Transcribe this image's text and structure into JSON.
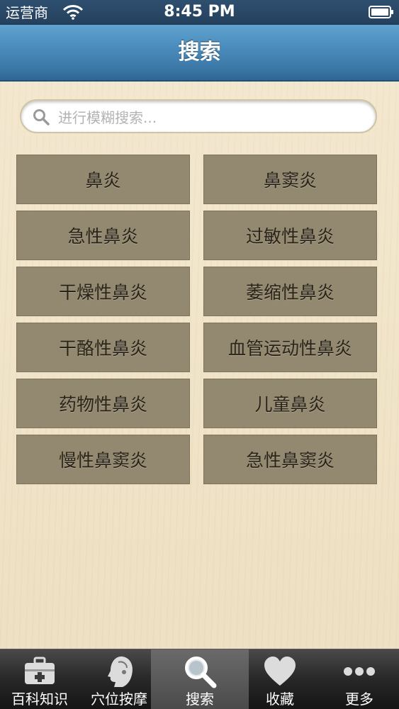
{
  "status_bar": {
    "carrier": "运营商",
    "time": "8:45 PM",
    "wifi_icon": "wifi-icon",
    "battery_icon": "battery-icon"
  },
  "nav": {
    "title": "搜索"
  },
  "search": {
    "placeholder": "进行模糊搜索...",
    "value": "",
    "icon": "search-icon"
  },
  "tags": [
    {
      "label": "鼻炎"
    },
    {
      "label": "鼻窦炎"
    },
    {
      "label": "急性鼻炎"
    },
    {
      "label": "过敏性鼻炎"
    },
    {
      "label": "干燥性鼻炎"
    },
    {
      "label": "萎缩性鼻炎"
    },
    {
      "label": "干酪性鼻炎"
    },
    {
      "label": "血管运动性鼻炎"
    },
    {
      "label": "药物性鼻炎"
    },
    {
      "label": "儿童鼻炎"
    },
    {
      "label": "慢性鼻窦炎"
    },
    {
      "label": "急性鼻窦炎"
    }
  ],
  "tabs": [
    {
      "label": "百科知识",
      "icon": "medical-kit-icon",
      "active": false
    },
    {
      "label": "穴位按摩",
      "icon": "head-profile-icon",
      "active": false
    },
    {
      "label": "搜索",
      "icon": "search-icon",
      "active": true
    },
    {
      "label": "收藏",
      "icon": "heart-icon",
      "active": false
    },
    {
      "label": "更多",
      "icon": "more-dots-icon",
      "active": false
    }
  ],
  "colors": {
    "nav_bar": "#4b8cbc",
    "tag_background": "#938870",
    "tag_text": "#2a2418",
    "content_background": "#f1e4c8",
    "tab_bar": "#2a2a2a"
  }
}
